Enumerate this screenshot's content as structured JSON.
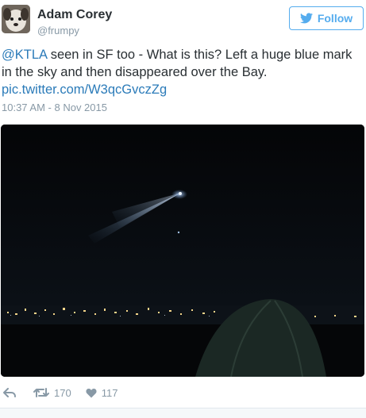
{
  "user": {
    "display_name": "Adam Corey",
    "handle": "@frumpy",
    "avatar_icon": "dog-avatar"
  },
  "follow_button": {
    "label": "Follow",
    "icon": "twitter-bird-icon",
    "color": "#55acee"
  },
  "tweet": {
    "mention": "@KTLA",
    "text": " seen in SF too - What is this? Left a huge blue mark in the sky and then disappeared over the Bay.",
    "link": "pic.twitter.com/W3qcGvczZg",
    "timestamp": "10:37 AM - 8 Nov 2015"
  },
  "media": {
    "description_icon": "night-sky-photo"
  },
  "actions": {
    "reply_icon": "reply-icon",
    "retweet_icon": "retweet-icon",
    "retweet_count": "170",
    "like_icon": "heart-icon",
    "like_count": "117"
  },
  "colors": {
    "link": "#2b7bb9",
    "meta": "#8899a6",
    "text": "#292f33"
  }
}
